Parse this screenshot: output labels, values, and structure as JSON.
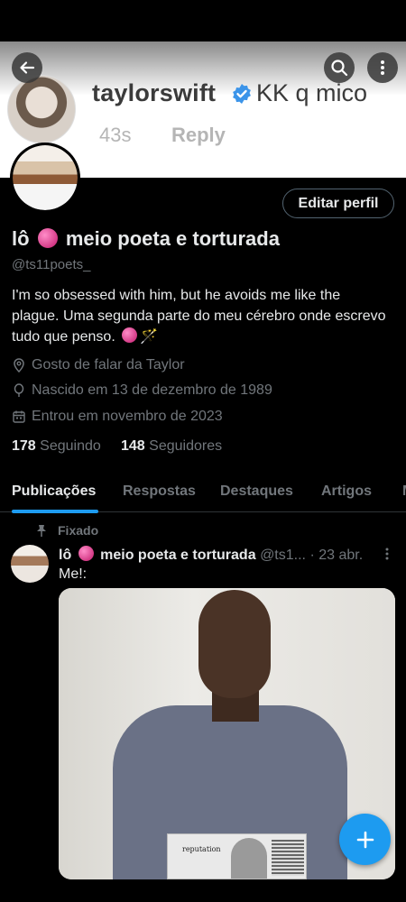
{
  "banner": {
    "username": "taylorswift",
    "comment": "KK q mico",
    "time": "43s",
    "reply_label": "Reply"
  },
  "header": {
    "edit_profile_label": "Editar perfil"
  },
  "profile": {
    "name_prefix": "lô",
    "name_suffix": "meio poeta e torturada",
    "handle": "@ts11poets_",
    "bio_line": "I'm so obsessed with him, but he avoids me like the plague. Uma segunda parte do meu cérebro onde escrevo tudo que penso.",
    "bio_emoji_wand": "🪄",
    "location": "Gosto de falar da Taylor",
    "birth": "Nascido em 13 de dezembro de 1989",
    "joined": "Entrou em novembro de 2023",
    "following_count": "178",
    "following_label": "Seguindo",
    "followers_count": "148",
    "followers_label": "Seguidores"
  },
  "tabs": [
    {
      "label": "Publicações",
      "active": true
    },
    {
      "label": "Respostas",
      "active": false
    },
    {
      "label": "Destaques",
      "active": false
    },
    {
      "label": "Artigos",
      "active": false
    },
    {
      "label": "M",
      "active": false
    }
  ],
  "post": {
    "pinned_label": "Fixado",
    "author_prefix": "lô",
    "author_suffix": "meio poeta e torturada",
    "handle_truncated": "@ts1...",
    "date": "· 23 abr.",
    "text": "Me!:",
    "image_album_text": "reputation"
  },
  "icons": {
    "back": "arrow-left-icon",
    "search": "search-icon",
    "more": "more-vertical-icon",
    "verified": "verified-badge-icon",
    "location": "location-pin-icon",
    "birth": "balloon-icon",
    "calendar": "calendar-icon",
    "pin": "pin-icon",
    "compose": "plus-icon",
    "yarn": "yarn-ball-emoji"
  },
  "colors": {
    "accent": "#1d9bf0",
    "background": "#000000",
    "secondary_text": "#71767b"
  }
}
